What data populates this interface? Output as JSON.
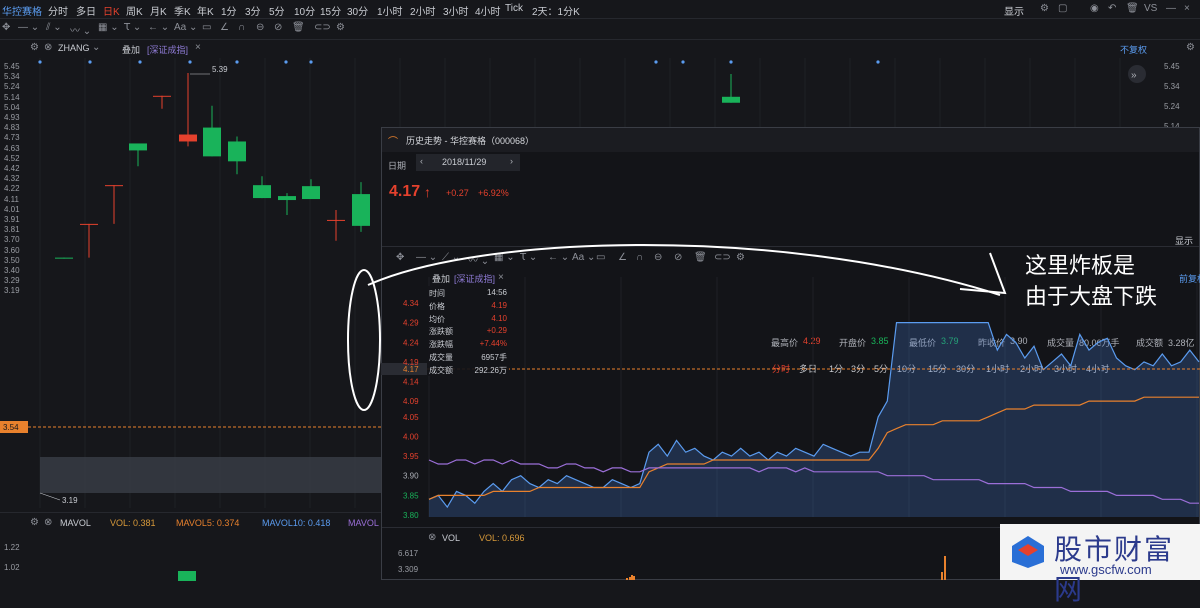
{
  "topbar": {
    "items": [
      "华控赛格",
      "分时",
      "多日",
      "日K",
      "周K",
      "月K",
      "季K",
      "年K",
      "1分",
      "3分",
      "5分",
      "10分",
      "15分",
      "30分",
      "1小时",
      "2小时",
      "3小时",
      "4小时",
      "Tick",
      "2天：1分K"
    ],
    "right": [
      "显示",
      "VS"
    ]
  },
  "indicator_row": {
    "formula": "ZHANG",
    "overlay": "叠加",
    "overlay_index": "[深证成指]",
    "restore": "不复权"
  },
  "main_chart": {
    "y_ticks": [
      "5.45",
      "5.34",
      "5.24",
      "5.14",
      "5.04",
      "4.93",
      "4.83",
      "4.73",
      "4.63",
      "4.52",
      "4.42",
      "4.32",
      "4.22",
      "4.11",
      "4.01",
      "3.91",
      "3.81",
      "3.70",
      "3.60",
      "3.50",
      "3.40",
      "3.29",
      "3.19"
    ],
    "right_ticks": [
      "5.45",
      "5.34",
      "5.24",
      "5.14"
    ],
    "high_label": "5.39",
    "low_label": "3.19",
    "last_label": "3.54",
    "candles": [
      {
        "open": 3.53,
        "close": 3.52,
        "high": 3.53,
        "low": 3.52
      },
      {
        "open": 3.87,
        "close": 3.87,
        "high": 3.87,
        "low": 3.53
      },
      {
        "open": 4.26,
        "close": 4.26,
        "high": 4.26,
        "low": 3.87
      },
      {
        "open": 4.68,
        "close": 4.61,
        "high": 4.68,
        "low": 4.45
      },
      {
        "open": 5.16,
        "close": 5.16,
        "high": 5.16,
        "low": 5.03
      },
      {
        "open": 4.7,
        "close": 4.77,
        "high": 5.39,
        "low": 4.65
      },
      {
        "open": 4.84,
        "close": 4.55,
        "high": 5.06,
        "low": 4.55
      },
      {
        "open": 4.7,
        "close": 4.5,
        "high": 4.75,
        "low": 4.37
      },
      {
        "open": 4.26,
        "close": 4.13,
        "high": 4.35,
        "low": 4.13
      },
      {
        "open": 4.15,
        "close": 4.11,
        "high": 4.18,
        "low": 3.96
      },
      {
        "open": 4.25,
        "close": 4.12,
        "high": 4.32,
        "low": 4.12
      },
      {
        "open": 3.91,
        "close": 3.91,
        "high": 4.01,
        "low": 3.7
      },
      {
        "open": 4.17,
        "close": 3.85,
        "high": 4.29,
        "low": 3.79
      }
    ],
    "right_candles": [
      {
        "open": 5.15,
        "close": 5.09,
        "high": 5.38,
        "low": 5.09
      }
    ]
  },
  "vol_row": {
    "name": "MAVOL",
    "vol": "VOL: 0.381",
    "mavol5": "MAVOL5: 0.374",
    "mavol10": "MAVOL10: 0.418",
    "mavol_trunc": "MAVOL",
    "axis": [
      "1.22",
      "1.02"
    ]
  },
  "popup": {
    "title": "历史走势 - 华控赛格（000068）",
    "date_label": "日期",
    "date": "2018/11/29",
    "price": "4.17",
    "change": "+0.27",
    "change_pct": "+6.92%",
    "stats": [
      {
        "label": "最高价",
        "value": "4.29",
        "color": "#e5412d"
      },
      {
        "label": "开盘价",
        "value": "3.85",
        "color": "#19b35a"
      },
      {
        "label": "最低价",
        "value": "3.79",
        "color": "#19b35a"
      },
      {
        "label": "昨收价",
        "value": "3.90",
        "color": "#aeb1b8"
      },
      {
        "label": "成交量",
        "value": "80.06万手",
        "color": "#aeb1b8"
      },
      {
        "label": "成交额",
        "value": "3.28亿",
        "color": "#aeb1b8"
      }
    ],
    "periods": [
      "分时",
      "多日",
      "1分",
      "3分",
      "5分",
      "10分",
      "15分",
      "30分",
      "1小时",
      "2小时",
      "3小时",
      "4小时"
    ],
    "show": "显示",
    "overlay": "叠加",
    "overlay_index": "[深证成指]",
    "front_restore": "前复权",
    "tooltip": [
      {
        "label": "时间",
        "value": "14:56",
        "color": "#c9ccd2"
      },
      {
        "label": "价格",
        "value": "4.19",
        "color": "#e5412d"
      },
      {
        "label": "均价",
        "value": "4.10",
        "color": "#e5412d"
      },
      {
        "label": "涨跌额",
        "value": "+0.29",
        "color": "#e5412d"
      },
      {
        "label": "涨跌幅",
        "value": "+7.44%",
        "color": "#e5412d"
      },
      {
        "label": "成交量",
        "value": "6957手",
        "color": "#c9ccd2"
      },
      {
        "label": "成交额",
        "value": "292.26万",
        "color": "#c9ccd2"
      }
    ],
    "y_ticks": [
      "4.34",
      "4.29",
      "4.24",
      "4.19",
      "4.14",
      "4.09",
      "4.05",
      "4.00",
      "3.95",
      "3.90",
      "3.85",
      "3.80"
    ],
    "last_label": "4.17",
    "vol_row": {
      "name": "VOL",
      "value": "VOL: 0.696"
    },
    "vol_axis": [
      "6.617",
      "3.309"
    ]
  },
  "annotation": {
    "line1": "这里炸板是",
    "line2": "由于大盘下跌"
  },
  "watermark": {
    "name": "股市财富网",
    "url": "www.gscfw.com"
  },
  "chart_data": {
    "type": "line",
    "title": "历史走势 - 华控赛格（000068） 2018/11/29",
    "xlabel": "",
    "ylabel": "",
    "ylim": [
      3.78,
      4.36
    ],
    "series": [
      {
        "name": "价格",
        "color": "#5b9cf0",
        "values": [
          3.84,
          3.85,
          3.82,
          3.86,
          3.85,
          3.83,
          3.86,
          3.88,
          3.86,
          3.89,
          3.9,
          3.88,
          3.87,
          3.89,
          3.88,
          3.9,
          3.89,
          3.88,
          3.87,
          3.87,
          3.89,
          3.88,
          3.87,
          3.88,
          3.96,
          3.98,
          3.95,
          3.99,
          3.96,
          3.97,
          3.95,
          3.94,
          3.96,
          3.95,
          3.97,
          3.95,
          3.96,
          3.94,
          3.96,
          3.95,
          3.97,
          3.96,
          3.95,
          3.98,
          3.97,
          3.96,
          3.95,
          3.96,
          3.96,
          4.05,
          4.09,
          4.29,
          4.29,
          4.29,
          4.29,
          4.29,
          4.29,
          4.29,
          4.29,
          4.29,
          4.29,
          4.29,
          4.22,
          4.26,
          4.24,
          4.2,
          4.23,
          4.17,
          4.19,
          4.21,
          4.18,
          4.26,
          4.22,
          4.24,
          4.25,
          4.2,
          4.18,
          4.17,
          4.19,
          4.18,
          4.21,
          4.18,
          4.19,
          4.22,
          4.19
        ]
      },
      {
        "name": "均价",
        "color": "#e8812d",
        "values": [
          3.84,
          3.85,
          3.85,
          3.85,
          3.85,
          3.85,
          3.85,
          3.86,
          3.86,
          3.86,
          3.86,
          3.86,
          3.87,
          3.87,
          3.87,
          3.87,
          3.87,
          3.87,
          3.87,
          3.87,
          3.87,
          3.87,
          3.87,
          3.87,
          3.91,
          3.92,
          3.93,
          3.93,
          3.93,
          3.93,
          3.93,
          3.94,
          3.94,
          3.94,
          3.94,
          3.94,
          3.94,
          3.94,
          3.94,
          3.94,
          3.94,
          3.94,
          3.94,
          3.94,
          3.94,
          3.94,
          3.94,
          3.94,
          3.94,
          3.97,
          4.01,
          4.02,
          4.03,
          4.03,
          4.03,
          4.03,
          4.04,
          4.04,
          4.04,
          4.04,
          4.04,
          4.05,
          4.06,
          4.07,
          4.07,
          4.07,
          4.08,
          4.08,
          4.08,
          4.08,
          4.08,
          4.08,
          4.09,
          4.09,
          4.09,
          4.09,
          4.09,
          4.09,
          4.1,
          4.1,
          4.1,
          4.1,
          4.1,
          4.1,
          4.1
        ]
      },
      {
        "name": "深证成指",
        "color": "#9b6fd8",
        "values": [
          3.94,
          3.93,
          3.93,
          3.94,
          3.94,
          3.93,
          3.94,
          3.94,
          3.93,
          3.94,
          3.93,
          3.93,
          3.93,
          3.92,
          3.92,
          3.93,
          3.93,
          3.92,
          3.92,
          3.91,
          3.92,
          3.92,
          3.91,
          3.91,
          3.92,
          3.92,
          3.92,
          3.92,
          3.92,
          3.92,
          3.92,
          3.92,
          3.92,
          3.92,
          3.92,
          3.92,
          3.91,
          3.92,
          3.92,
          3.92,
          3.91,
          3.92,
          3.91,
          3.91,
          3.91,
          3.91,
          3.91,
          3.91,
          3.91,
          3.91,
          3.9,
          3.9,
          3.9,
          3.9,
          3.9,
          3.89,
          3.89,
          3.89,
          3.89,
          3.89,
          3.89,
          3.88,
          3.88,
          3.88,
          3.88,
          3.88,
          3.87,
          3.87,
          3.87,
          3.87,
          3.86,
          3.86,
          3.86,
          3.86,
          3.86,
          3.85,
          3.85,
          3.85,
          3.85,
          3.85,
          3.84,
          3.84,
          3.84,
          3.83,
          3.83
        ]
      }
    ],
    "volume_ticks": [
      "6.617",
      "3.309"
    ]
  }
}
